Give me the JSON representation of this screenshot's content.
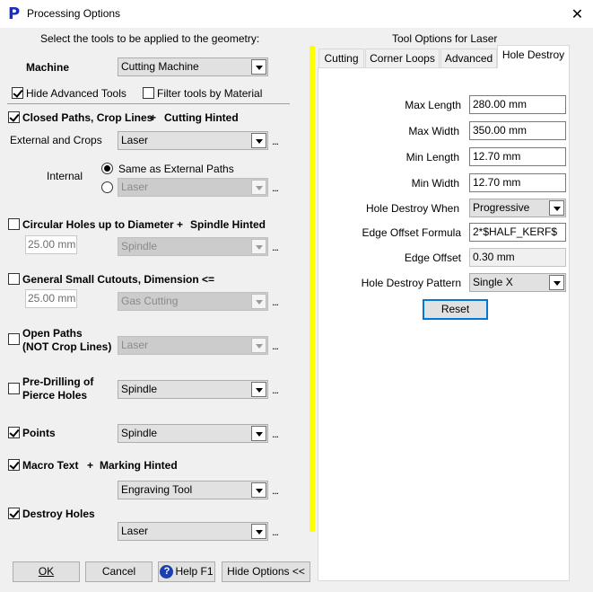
{
  "window": {
    "title": "Processing Options",
    "close_glyph": "✕",
    "app_icon": "P"
  },
  "left": {
    "instruction": "Select the tools to be applied to the geometry:",
    "machine": {
      "label": "Machine",
      "value": "Cutting Machine"
    },
    "hide_advanced": {
      "label": "Hide Advanced Tools",
      "checked": true
    },
    "filter_material": {
      "label": "Filter tools by Material",
      "checked": false
    },
    "closed_paths": {
      "title": "Closed Paths,  Crop Lines",
      "plus": "+",
      "hint": "Cutting Hinted",
      "checked": true,
      "external_label": "External and Crops",
      "external_value": "Laser",
      "internal_label": "Internal",
      "same_as_external": "Same as External Paths",
      "internal_value": "Laser"
    },
    "circular_holes": {
      "title": "Circular Holes up to Diameter",
      "plus": "+",
      "hint": "Spindle Hinted",
      "checked": false,
      "diameter": "25.00 mm",
      "tool": "Spindle"
    },
    "small_cutouts": {
      "title": "General Small Cutouts, Dimension <=",
      "checked": false,
      "dimension": "25.00 mm",
      "tool": "Gas Cutting"
    },
    "open_paths": {
      "title_line1": "Open Paths",
      "title_line2": "(NOT Crop Lines)",
      "checked": false,
      "tool": "Laser"
    },
    "pre_drilling": {
      "title_line1": "Pre-Drilling of",
      "title_line2": "Pierce Holes",
      "checked": false,
      "tool": "Spindle"
    },
    "points": {
      "title": "Points",
      "checked": true,
      "tool": "Spindle"
    },
    "macro_text": {
      "title": "Macro Text",
      "plus": "+",
      "hint": "Marking Hinted",
      "checked": true,
      "tool": "Engraving Tool"
    },
    "destroy_holes": {
      "title": "Destroy Holes",
      "checked": true,
      "tool": "Laser"
    },
    "ellipsis": "..."
  },
  "buttons": {
    "ok": "OK",
    "cancel": "Cancel",
    "help_icon": "?",
    "help": "Help F1",
    "hide_options": "Hide Options <<"
  },
  "right": {
    "heading": "Tool Options for Laser",
    "tabs": [
      "Cutting",
      "Corner Loops",
      "Advanced",
      "Hole Destroy"
    ],
    "active_tab": "Hole Destroy",
    "fields": {
      "max_length": {
        "label": "Max Length",
        "value": "280.00 mm"
      },
      "max_width": {
        "label": "Max Width",
        "value": "350.00 mm"
      },
      "min_length": {
        "label": "Min Length",
        "value": "12.70 mm"
      },
      "min_width": {
        "label": "Min Width",
        "value": "12.70 mm"
      },
      "destroy_when": {
        "label": "Hole Destroy When",
        "value": "Progressive"
      },
      "edge_formula": {
        "label": "Edge Offset Formula",
        "value": "2*$HALF_KERF$"
      },
      "edge_offset": {
        "label": "Edge Offset",
        "value": "0.30 mm"
      },
      "pattern": {
        "label": "Hole Destroy Pattern",
        "value": "Single X"
      }
    },
    "reset": "Reset"
  },
  "colors": {
    "splitter": "#ffff00",
    "focus": "#0078d7",
    "app_icon": "#1a2fb8"
  }
}
